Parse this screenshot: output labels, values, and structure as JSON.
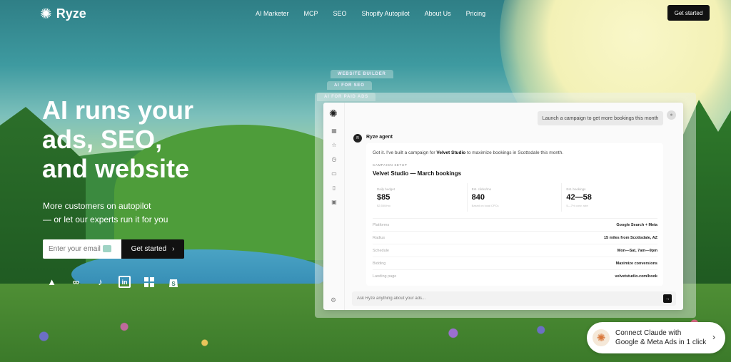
{
  "brand": {
    "name": "Ryze",
    "logo_icon": "asterisk-burst-icon"
  },
  "nav": {
    "links": [
      "AI Marketer",
      "MCP",
      "SEO",
      "Shopify Autopilot",
      "About Us",
      "Pricing"
    ],
    "cta": "Get started"
  },
  "hero": {
    "title_lines": [
      "AI runs your",
      "ads, SEO,",
      "and website"
    ],
    "subtitle_lines": [
      "More customers on autopilot",
      "— or let our experts run it for you"
    ],
    "email_placeholder": "Enter your email",
    "cta": "Get started",
    "platform_icons": [
      "google-ads-icon",
      "meta-icon",
      "tiktok-icon",
      "linkedin-icon",
      "microsoft-icon",
      "shopify-icon"
    ]
  },
  "product": {
    "stack_tabs": [
      "WEBSITE BUILDER",
      "AI FOR SEO",
      "AI FOR PAID ADS"
    ],
    "user_message": "Launch a campaign to get more bookings this month",
    "agent_name": "Ryze agent",
    "agent_intro_prefix": "Got it. I've built a campaign for ",
    "agent_intro_business": "Velvet Studio",
    "agent_intro_suffix": " to maximize bookings in Scottsdale this month.",
    "setup_label": "CAMPAIGN SETUP",
    "campaign_title": "Velvet Studio — March bookings",
    "metrics": [
      {
        "label": "Daily budget",
        "value": "$85",
        "note": "$2,550/mo"
      },
      {
        "label": "Est. clicks/mo",
        "value": "840",
        "note": "Based on local CPCs"
      },
      {
        "label": "Est. bookings",
        "value": "42—58",
        "note": "5—7% conv. rate"
      }
    ],
    "rows": [
      {
        "key": "Platforms",
        "value": "Google Search + Meta"
      },
      {
        "key": "Radius",
        "value": "15 miles from Scottsdale, AZ"
      },
      {
        "key": "Schedule",
        "value": "Mon—Sat, 7am—9pm"
      },
      {
        "key": "Bidding",
        "value": "Maximize conversions"
      },
      {
        "key": "Landing page",
        "value": "velvetstudio.com/book"
      }
    ],
    "composer_placeholder": "Ask Ryze anything about your ads..."
  },
  "promo": {
    "line1": "Connect Claude with",
    "line2": "Google & Meta Ads in 1 click"
  }
}
